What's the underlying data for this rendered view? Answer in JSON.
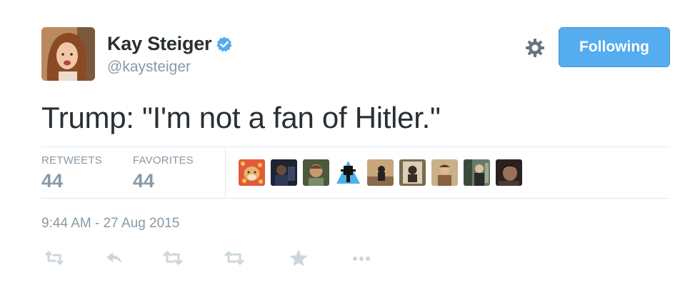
{
  "user": {
    "display_name": "Kay Steiger",
    "screen_name": "@kaysteiger",
    "verified_icon": "verified-badge-icon"
  },
  "header": {
    "settings_icon": "gear-icon",
    "follow_button_label": "Following"
  },
  "tweet": {
    "text": "Trump: \"I'm not a fan of Hitler.\"",
    "timestamp": "9:44 AM - 27 Aug 2015"
  },
  "stats": {
    "retweets_label": "RETWEETS",
    "retweets_value": "44",
    "favorites_label": "FAVORITES",
    "favorites_value": "44"
  },
  "favoriters": {
    "count": 9
  },
  "actions": [
    {
      "name": "retweet-count-icon"
    },
    {
      "name": "reply-icon"
    },
    {
      "name": "retweet-icon"
    },
    {
      "name": "retweet-icon-secondary"
    },
    {
      "name": "favorite-star-icon"
    },
    {
      "name": "more-options-icon"
    }
  ],
  "colors": {
    "accent": "#55acee",
    "text": "#292f33",
    "muted": "#8899a6",
    "divider": "#e1e8ed"
  }
}
